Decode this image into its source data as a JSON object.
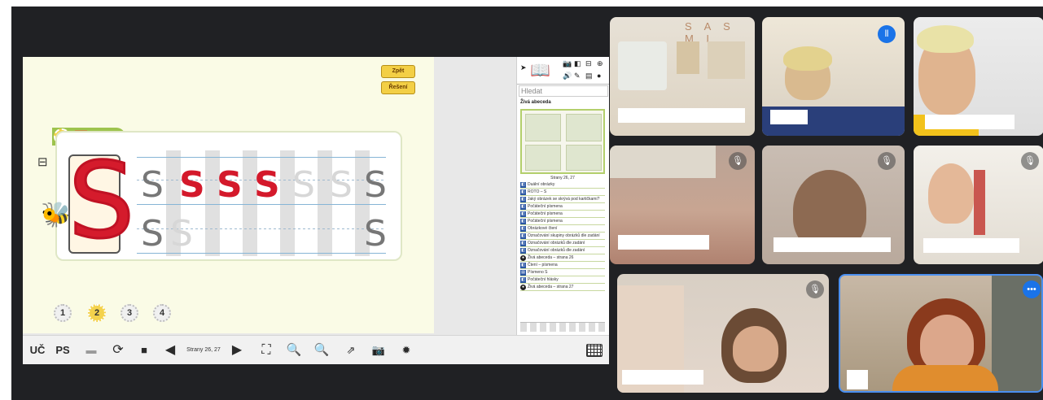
{
  "lesson": {
    "buttons": {
      "back": "Zpět",
      "solution": "Řešení"
    },
    "task": {
      "number": "2",
      "icon": "pencil-icon",
      "letter": "S."
    },
    "letters": {
      "big": "S",
      "row1": [
        "S",
        "S",
        "S",
        "S",
        "S",
        "S",
        "S"
      ],
      "row2": [
        "S",
        "S",
        "S"
      ]
    },
    "pages": [
      "1",
      "2",
      "3",
      "4"
    ],
    "active_page": "2"
  },
  "panel": {
    "search_placeholder": "Hledat",
    "title": "Živá abeceda",
    "thumb_caption": "Strany 26, 27",
    "items": [
      "Duální obrázky",
      "ROTO – S",
      "Jaký obrázek se skrývá pod kartičkami?",
      "Počáteční písmena",
      "Počáteční písmena",
      "Počáteční písmena",
      "Obrázkové čtení",
      "Označování skupiny obrázků dle zadání",
      "Označování obrázků dle zadání",
      "Označování obrázků dle zadání",
      "Živá abeceda – strana 26",
      "Čtení – písmena",
      "Písmeno S",
      "Počáteční hlásky",
      "Živá abeceda – strana 27"
    ]
  },
  "toolbar": {
    "uc": "UČ",
    "ps": "PS",
    "pages_label": "Strany 26, 27"
  },
  "participants": {
    "thumb_letters": "S A S M L"
  },
  "colors": {
    "meet_bg": "#202124",
    "accent_red": "#d4192b",
    "accent_yellow": "#f4d24c",
    "tile_highlight": "#4a8ff0"
  }
}
